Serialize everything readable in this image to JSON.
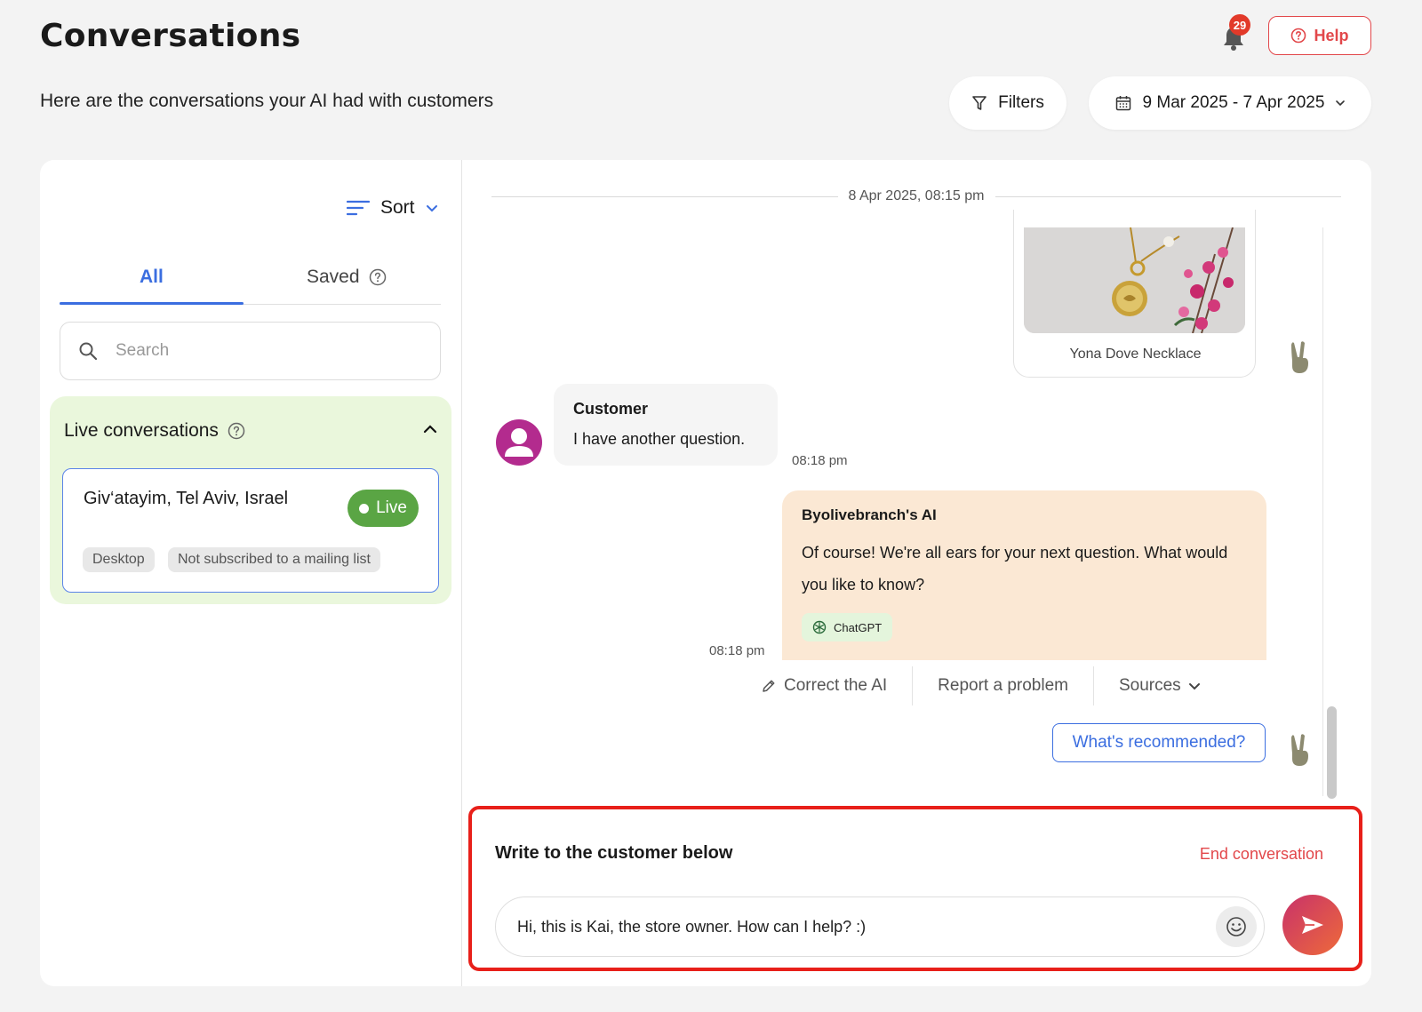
{
  "header": {
    "title": "Conversations",
    "subtitle": "Here are the conversations your AI had with customers",
    "notification_count": "29",
    "help_label": "Help",
    "filters_label": "Filters",
    "date_range": "9 Mar 2025 - 7 Apr 2025"
  },
  "sidebar": {
    "sort_label": "Sort",
    "tabs": [
      {
        "label": "All",
        "active": true
      },
      {
        "label": "Saved",
        "active": false
      }
    ],
    "search_placeholder": "Search",
    "live_section_title": "Live conversations",
    "conversations": [
      {
        "location": "Giv‘atayim, Tel Aviv, Israel",
        "status": "Live",
        "tags": [
          "Desktop",
          "Not subscribed to a mailing list"
        ]
      }
    ]
  },
  "chat": {
    "date_separator": "8 Apr 2025, 08:15 pm",
    "product_name": "Yona Dove Necklace",
    "customer_message": {
      "sender": "Customer",
      "text": "I have another question.",
      "time": "08:18 pm"
    },
    "ai_message": {
      "sender": "Byolivebranch's AI",
      "text": "Of course! We're all ears for your next question. What would you like to know?",
      "source_chip": "ChatGPT",
      "time": "08:18 pm"
    },
    "actions": {
      "correct": "Correct the AI",
      "report": "Report a problem",
      "sources": "Sources"
    },
    "suggestion": "What's recommended?"
  },
  "composer": {
    "title": "Write to the customer below",
    "end_label": "End conversation",
    "message_value": "Hi, this is Kai, the store owner. How can I help? :)"
  },
  "colors": {
    "accent_blue": "#3b6ee0",
    "alert_red": "#e2474a",
    "live_green": "#5aa544",
    "ai_bubble": "#fbe8d4",
    "live_section_bg": "#eaf7dc"
  }
}
